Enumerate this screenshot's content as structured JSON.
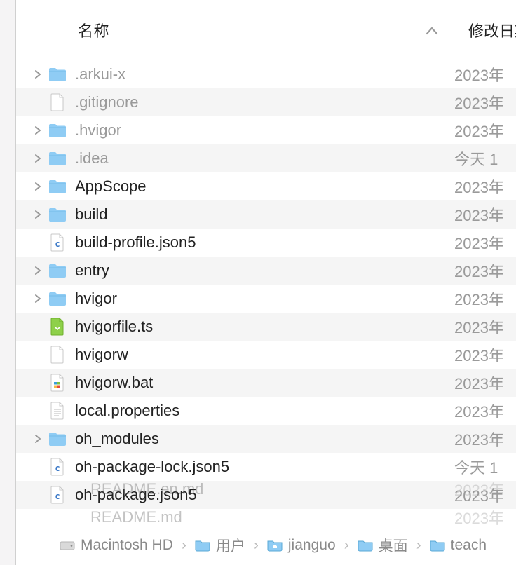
{
  "header": {
    "name_label": "名称",
    "date_label": "修改日期"
  },
  "rows": [
    {
      "name": ".arkui-x",
      "type": "folder",
      "expandable": true,
      "dim": true,
      "date": "2023年"
    },
    {
      "name": ".gitignore",
      "type": "file",
      "expandable": false,
      "dim": true,
      "date": "2023年"
    },
    {
      "name": ".hvigor",
      "type": "folder",
      "expandable": true,
      "dim": true,
      "date": "2023年"
    },
    {
      "name": ".idea",
      "type": "folder",
      "expandable": true,
      "dim": true,
      "date": "今天 1"
    },
    {
      "name": "AppScope",
      "type": "folder",
      "expandable": true,
      "dim": false,
      "date": "2023年"
    },
    {
      "name": "build",
      "type": "folder",
      "expandable": true,
      "dim": false,
      "date": "2023年"
    },
    {
      "name": "build-profile.json5",
      "type": "file-c",
      "expandable": false,
      "dim": false,
      "date": "2023年"
    },
    {
      "name": "entry",
      "type": "folder",
      "expandable": true,
      "dim": false,
      "date": "2023年"
    },
    {
      "name": "hvigor",
      "type": "folder",
      "expandable": true,
      "dim": false,
      "date": "2023年"
    },
    {
      "name": "hvigorfile.ts",
      "type": "file-ts",
      "expandable": false,
      "dim": false,
      "date": "2023年"
    },
    {
      "name": "hvigorw",
      "type": "file",
      "expandable": false,
      "dim": false,
      "date": "2023年"
    },
    {
      "name": "hvigorw.bat",
      "type": "file-bat",
      "expandable": false,
      "dim": false,
      "date": "2023年"
    },
    {
      "name": "local.properties",
      "type": "file-txt",
      "expandable": false,
      "dim": false,
      "date": "2023年"
    },
    {
      "name": "oh_modules",
      "type": "folder",
      "expandable": true,
      "dim": false,
      "date": "2023年"
    },
    {
      "name": "oh-package-lock.json5",
      "type": "file-c",
      "expandable": false,
      "dim": false,
      "date": "今天 1"
    },
    {
      "name": "oh-package.json5",
      "type": "file-c",
      "expandable": false,
      "dim": false,
      "date": "2023年"
    }
  ],
  "ghosts": [
    {
      "name": "README.en.md",
      "date": "2023年"
    },
    {
      "name": "README.md",
      "date": "2023年"
    }
  ],
  "pathbar": {
    "disk": "Macintosh HD",
    "crumbs": [
      "用户",
      "jianguo",
      "桌面",
      "teach"
    ]
  }
}
